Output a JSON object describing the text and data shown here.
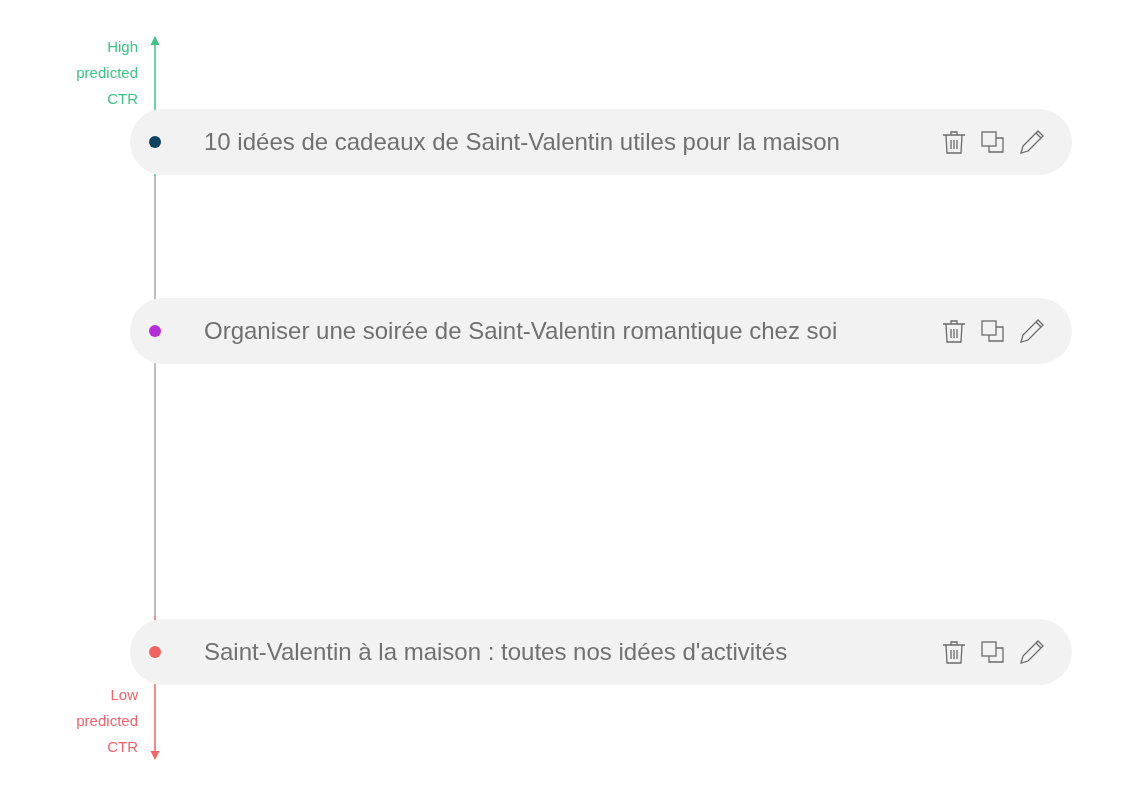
{
  "axis": {
    "top_label": "High predicted CTR",
    "bottom_label": "Low predicted CTR"
  },
  "headlines": [
    {
      "text": "10 idées de cadeaux de Saint-Valentin utiles pour la maison",
      "color": "#0d4261"
    },
    {
      "text": "Organiser une soirée de Saint-Valentin romantique chez soi",
      "color": "#b52fd8"
    },
    {
      "text": "Saint-Valentin à la maison : toutes nos idées d'activités",
      "color": "#f26262"
    }
  ]
}
